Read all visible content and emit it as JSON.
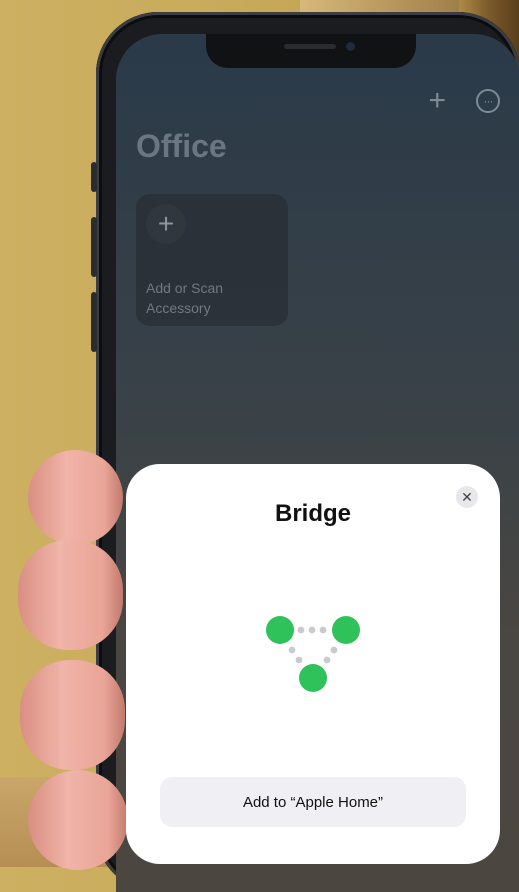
{
  "home": {
    "room_title": "Office",
    "tile_label_line1": "Add or Scan",
    "tile_label_line2": "Accessory",
    "add_icon_glyph": "+",
    "more_icon_glyph": "···"
  },
  "sheet": {
    "title": "Bridge",
    "close_glyph": "✕",
    "add_button_label": "Add to “Apple Home”"
  },
  "colors": {
    "accent_green": "#2fc15a",
    "sheet_background": "#ffffff"
  },
  "icons": [
    "plus-icon",
    "more-icon",
    "close-icon",
    "bridge-icon"
  ]
}
